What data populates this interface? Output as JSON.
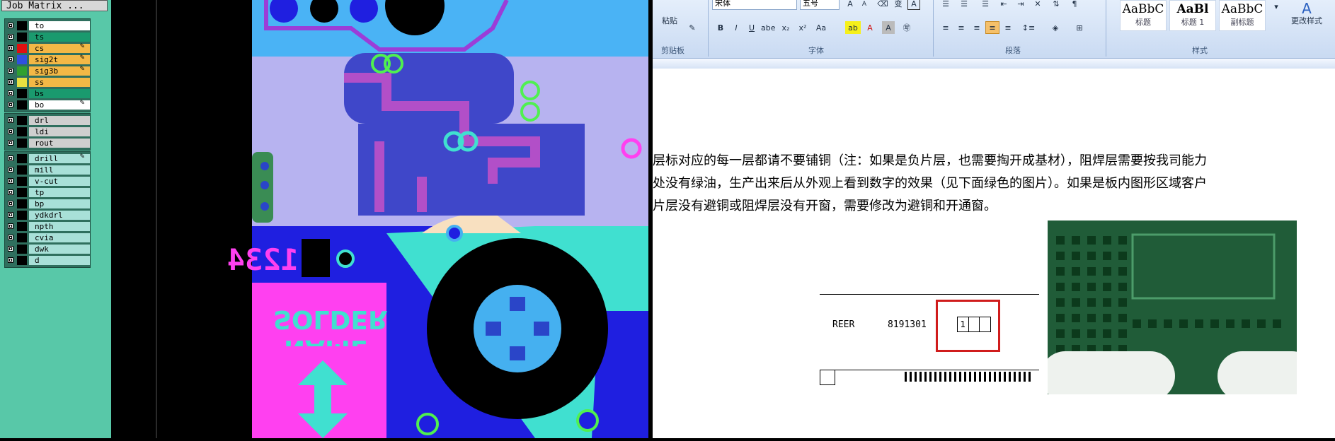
{
  "cam": {
    "window_title": "Job Matrix ...",
    "layer_groups": [
      {
        "rows": [
          {
            "name": "to",
            "swatch": "#000000",
            "bg": "#ffffff",
            "locked": false
          },
          {
            "name": "ts",
            "swatch": "#000000",
            "bg": "#1a9a6e",
            "locked": false
          },
          {
            "name": "cs",
            "swatch": "#e01010",
            "bg": "#f3b846",
            "locked": true
          },
          {
            "name": "sig2t",
            "swatch": "#3050e0",
            "bg": "#f3b846",
            "locked": true
          },
          {
            "name": "sig3b",
            "swatch": "#30a030",
            "bg": "#f3b846",
            "locked": true
          },
          {
            "name": "ss",
            "swatch": "#e8e040",
            "bg": "#f3b846",
            "locked": false
          },
          {
            "name": "bs",
            "swatch": "#000000",
            "bg": "#1a9a6e",
            "locked": false
          },
          {
            "name": "bo",
            "swatch": "#000000",
            "bg": "#ffffff",
            "locked": true
          }
        ]
      },
      {
        "rows": [
          {
            "name": "drl",
            "swatch": "#000000",
            "bg": "#cfcfcf",
            "locked": false
          },
          {
            "name": "ldi",
            "swatch": "#000000",
            "bg": "#cfcfcf",
            "locked": false
          },
          {
            "name": "rout",
            "swatch": "#000000",
            "bg": "#cfcfcf",
            "locked": false
          }
        ]
      },
      {
        "rows": [
          {
            "name": "drill",
            "swatch": "#000000",
            "bg": "#a8e0d8",
            "locked": true
          },
          {
            "name": "mill",
            "swatch": "#000000",
            "bg": "#a8e0d8",
            "locked": false
          },
          {
            "name": "v-cut",
            "swatch": "#000000",
            "bg": "#a8e0d8",
            "locked": false
          },
          {
            "name": "tp",
            "swatch": "#000000",
            "bg": "#a8e0d8",
            "locked": false
          },
          {
            "name": "bp",
            "swatch": "#000000",
            "bg": "#a8e0d8",
            "locked": false
          },
          {
            "name": "ydkdrl",
            "swatch": "#000000",
            "bg": "#a8e0d8",
            "locked": false
          },
          {
            "name": "npth",
            "swatch": "#000000",
            "bg": "#a8e0d8",
            "locked": false
          },
          {
            "name": "cvia",
            "swatch": "#000000",
            "bg": "#a8e0d8",
            "locked": false
          },
          {
            "name": "dwk",
            "swatch": "#000000",
            "bg": "#a8e0d8",
            "locked": false
          },
          {
            "name": "d",
            "swatch": "#000000",
            "bg": "#a8e0d8",
            "locked": false
          }
        ]
      }
    ],
    "artwork_text": {
      "refdes_numbers": "1234",
      "solder_line1": "SOLDER",
      "solder_line2": "NAME"
    }
  },
  "word": {
    "font_name": "宋体",
    "font_size": "五号",
    "groups": {
      "clipboard": "剪贴板",
      "font": "字体",
      "paragraph": "段落",
      "styles": "样式"
    },
    "paste_label": "粘贴",
    "change_styles_label": "更改样式",
    "styles": [
      {
        "sample": "AaBbC",
        "name": "标题"
      },
      {
        "sample": "AaBl",
        "name": "标题 1"
      },
      {
        "sample": "AaBbC",
        "name": "副标题"
      }
    ],
    "font_buttons": [
      "B",
      "I",
      "U",
      "abe",
      "x₂",
      "x²",
      "Aa"
    ],
    "doc_lines": [
      "层标对应的每一层都请不要铺铜（注：如果是负片层，也需要掏开成基材），阻焊层需要按我司能力",
      "处没有绿油，生产出来后从外观上看到数字的效果（见下面绿色的图片）。如果是板内图形区域客户",
      "片层没有避铜或阻焊层没有开窗，需要修改为避铜和开通窗。"
    ],
    "figure": {
      "left_text": "REER",
      "number_text": "8191301",
      "cell_1": "1"
    }
  }
}
